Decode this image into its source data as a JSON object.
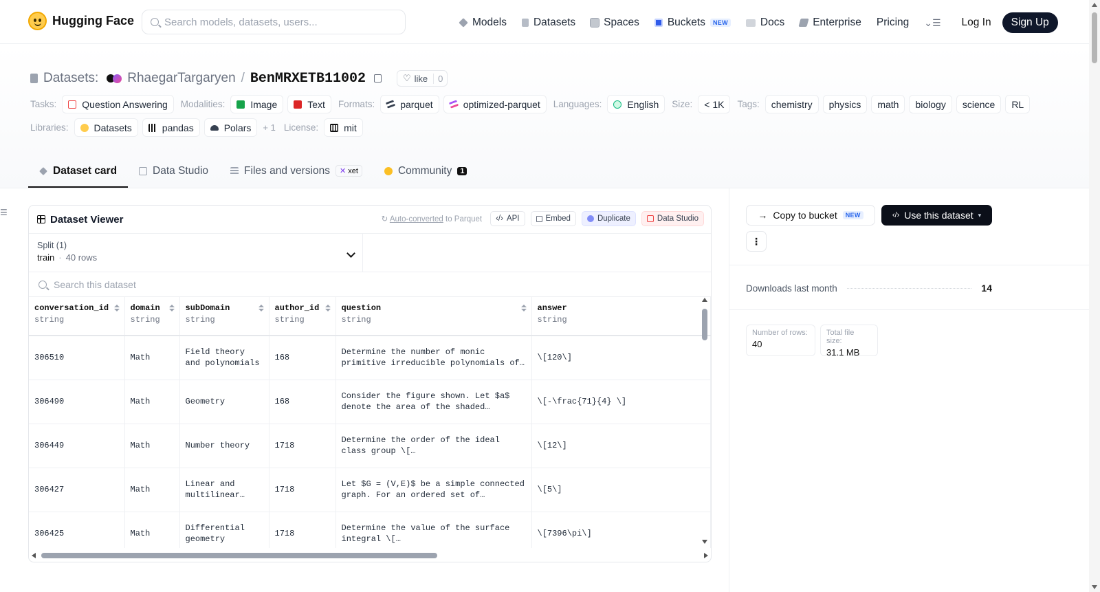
{
  "nav": {
    "brand": "Hugging Face",
    "search_placeholder": "Search models, datasets, users...",
    "links": [
      {
        "label": "Models",
        "icon": "cube-icon"
      },
      {
        "label": "Datasets",
        "icon": "database-icon"
      },
      {
        "label": "Spaces",
        "icon": "grid-icon"
      },
      {
        "label": "Buckets",
        "icon": "bucket-icon",
        "badge": "NEW"
      },
      {
        "label": "Docs",
        "icon": "book-icon"
      },
      {
        "label": "Enterprise",
        "icon": "enterprise-icon"
      },
      {
        "label": "Pricing"
      }
    ],
    "login": "Log In",
    "signup": "Sign Up"
  },
  "header": {
    "kind": "Datasets:",
    "owner": "RhaegarTargaryen",
    "separator": "/",
    "repo": "BenMRXETB11002",
    "like_label": "like",
    "like_count": "0",
    "tasks_label": "Tasks:",
    "task": "Question Answering",
    "modalities_label": "Modalities:",
    "modalities": [
      "Image",
      "Text"
    ],
    "formats_label": "Formats:",
    "formats": [
      "parquet",
      "optimized-parquet"
    ],
    "languages_label": "Languages:",
    "language": "English",
    "size_label": "Size:",
    "size": "< 1K",
    "tags_label": "Tags:",
    "tags": [
      "chemistry",
      "physics",
      "math",
      "biology",
      "science",
      "RL"
    ],
    "libraries_label": "Libraries:",
    "libraries": [
      "Datasets",
      "pandas",
      "Polars"
    ],
    "libraries_more": "+ 1",
    "license_label": "License:",
    "license": "mit"
  },
  "tabs": {
    "card": "Dataset card",
    "studio": "Data Studio",
    "files": "Files and versions",
    "files_badge": "xet",
    "community": "Community",
    "community_count": "1"
  },
  "viewer": {
    "title": "Dataset Viewer",
    "autoconv_link": "Auto-converted",
    "autoconv_rest": " to Parquet",
    "api": "API",
    "embed": "Embed",
    "duplicate": "Duplicate",
    "data_studio": "Data Studio",
    "split_label": "Split (1)",
    "split_name": "train",
    "split_dot": "·",
    "split_rows": "40 rows",
    "search_placeholder": "Search this dataset",
    "columns": [
      {
        "name": "conversation_id",
        "type": "string"
      },
      {
        "name": "domain",
        "type": "string"
      },
      {
        "name": "subDomain",
        "type": "string"
      },
      {
        "name": "author_id",
        "type": "string"
      },
      {
        "name": "question",
        "type": "string"
      },
      {
        "name": "answer",
        "type": "string"
      }
    ],
    "rows": [
      [
        "306510",
        "Math",
        "Field theory and polynomials",
        "168",
        "Determine the number of monic primitive irreducible polynomials of…",
        "\\[120\\]"
      ],
      [
        "306490",
        "Math",
        "Geometry",
        "168",
        "Consider the figure shown. Let $a$ denote the area of the shaded region.…",
        "\\[-\\frac{71}{4} \\]"
      ],
      [
        "306449",
        "Math",
        "Number theory",
        "1718",
        "Determine the order of the ideal class group \\[ \\mathrm{Cl}\\!\\left(\\mathbb{Q…",
        "\\[12\\]"
      ],
      [
        "306427",
        "Math",
        "Linear and multilinear…",
        "1718",
        "Let $G = (V,E)$ be a simple connected graph. For an ordered set of vertices…",
        "\\[5\\]"
      ],
      [
        "306425",
        "Math",
        "Differential geometry",
        "1718",
        "Determine the value of the surface integral \\[…",
        "\\[7396\\pi\\]"
      ]
    ]
  },
  "sidebar": {
    "copy_bucket": "Copy to bucket",
    "copy_badge": "NEW",
    "use_dataset": "Use this dataset",
    "more": "⋮",
    "downloads_label": "Downloads last month",
    "downloads": "14",
    "rows_label": "Number of rows:",
    "rows": "40",
    "size_label": "Total file size:",
    "size": "31.1 MB"
  },
  "colors": {
    "accent_dark": "#0b0f19",
    "nav_text": "#1f2937",
    "muted": "#9ca3af",
    "new_badge": "#2563eb"
  }
}
